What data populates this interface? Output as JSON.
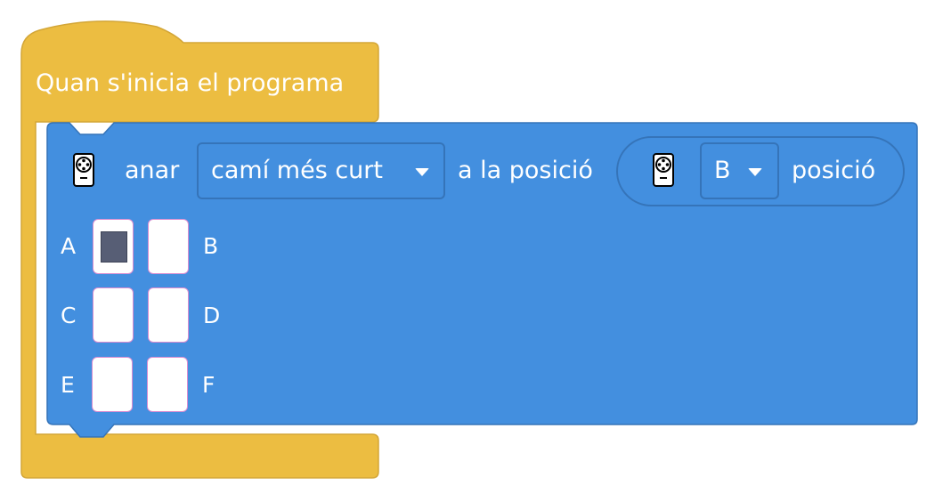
{
  "hat_block": {
    "title": "Quan s'inicia el programa",
    "color": "#ecbd41"
  },
  "motion_block": {
    "color": "#438fdf",
    "verb": "anar",
    "route_dropdown": {
      "value": "camí més curt"
    },
    "connector": "a la posició",
    "position_reporter": {
      "icon": "robot-icon",
      "dropdown_value": "B",
      "label": "posició"
    },
    "grid": {
      "rows": [
        {
          "left_label": "A",
          "right_label": "B",
          "left_selected": true,
          "right_selected": false
        },
        {
          "left_label": "C",
          "right_label": "D",
          "left_selected": false,
          "right_selected": false
        },
        {
          "left_label": "E",
          "right_label": "F",
          "left_selected": false,
          "right_selected": false
        }
      ]
    }
  }
}
